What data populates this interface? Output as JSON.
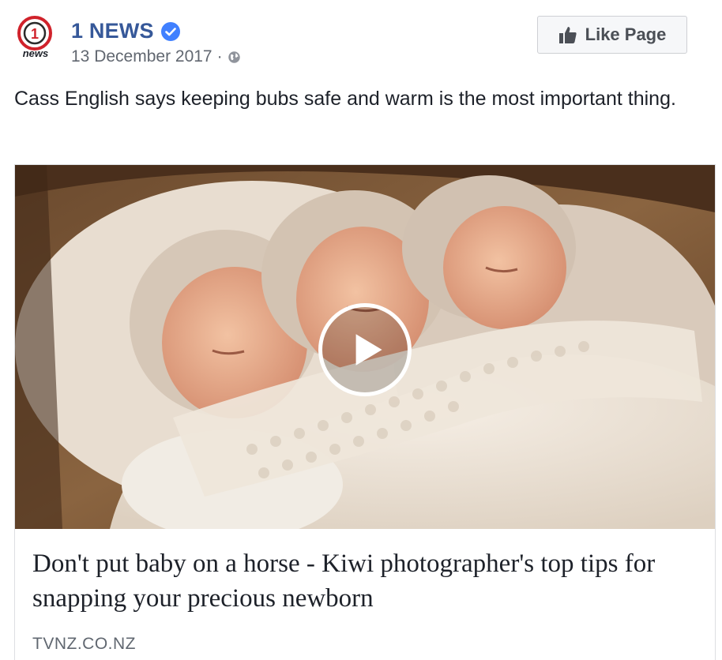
{
  "post": {
    "page_name": "1 NEWS",
    "avatar_text": "news",
    "avatar_number": "1",
    "date": "13 December 2017",
    "separator": "·",
    "privacy_icon": "globe-icon",
    "verified_icon": "verified-badge-icon",
    "like_button_label": "Like Page",
    "like_icon": "thumbs-up-icon",
    "text": "Cass English says keeping bubs safe and warm is the most important thing."
  },
  "attachment": {
    "media_type": "video",
    "play_icon": "play-icon",
    "title": "Don't put baby on a horse - Kiwi photographer's top tips for snapping your precious newborn",
    "domain": "TVNZ.CO.NZ"
  },
  "colors": {
    "link_blue": "#365899",
    "brand_red": "#d0222b",
    "verified_blue": "#4080ff",
    "meta_grey": "#616770"
  }
}
